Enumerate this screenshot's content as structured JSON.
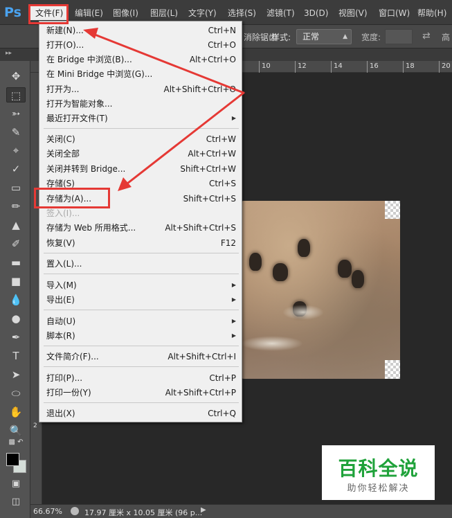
{
  "app": {
    "logo": "Ps"
  },
  "menubar": {
    "items": [
      "文件(F)",
      "编辑(E)",
      "图像(I)",
      "图层(L)",
      "文字(Y)",
      "选择(S)",
      "滤镜(T)",
      "3D(D)",
      "视图(V)",
      "窗口(W)",
      "帮助(H)"
    ]
  },
  "options_bar": {
    "partial_text": "消除锯齿",
    "style_label": "样式:",
    "style_value": "正常",
    "width_label": "宽度:",
    "height_label": "高"
  },
  "ruler": {
    "top_numbers": [
      "10",
      "12",
      "14",
      "16",
      "18",
      "20"
    ],
    "left_numbers": [
      "2"
    ]
  },
  "tools": [
    "move-tool",
    "marquee-tool",
    "lasso-tool",
    "quick-select-tool",
    "crop-tool",
    "eyedropper-tool",
    "healing-brush-tool",
    "brush-tool",
    "clone-stamp-tool",
    "history-brush-tool",
    "eraser-tool",
    "gradient-tool",
    "blur-tool",
    "dodge-tool",
    "pen-tool",
    "type-tool",
    "path-select-tool",
    "ellipse-tool",
    "hand-tool",
    "zoom-tool"
  ],
  "colors": {
    "foreground": "#000000",
    "background": "#d4ddd8",
    "highlight": "#e53935",
    "watermark_green": "#1fa23a"
  },
  "file_menu": {
    "groups": [
      [
        {
          "label": "新建(N)...",
          "shortcut": "Ctrl+N"
        },
        {
          "label": "打开(O)...",
          "shortcut": "Ctrl+O"
        },
        {
          "label": "在 Bridge 中浏览(B)...",
          "shortcut": "Alt+Ctrl+O"
        },
        {
          "label": "在 Mini Bridge 中浏览(G)...",
          "shortcut": ""
        },
        {
          "label": "打开为...",
          "shortcut": "Alt+Shift+Ctrl+O"
        },
        {
          "label": "打开为智能对象...",
          "shortcut": ""
        },
        {
          "label": "最近打开文件(T)",
          "shortcut": "",
          "submenu": true
        }
      ],
      [
        {
          "label": "关闭(C)",
          "shortcut": "Ctrl+W"
        },
        {
          "label": "关闭全部",
          "shortcut": "Alt+Ctrl+W"
        },
        {
          "label": "关闭并转到 Bridge...",
          "shortcut": "Shift+Ctrl+W"
        },
        {
          "label": "存储(S)",
          "shortcut": "Ctrl+S"
        },
        {
          "label": "存储为(A)...",
          "shortcut": "Shift+Ctrl+S"
        },
        {
          "label": "签入(I)...",
          "shortcut": "",
          "disabled": true
        },
        {
          "label": "存储为 Web 所用格式...",
          "shortcut": "Alt+Shift+Ctrl+S"
        },
        {
          "label": "恢复(V)",
          "shortcut": "F12"
        }
      ],
      [
        {
          "label": "置入(L)...",
          "shortcut": ""
        }
      ],
      [
        {
          "label": "导入(M)",
          "shortcut": "",
          "submenu": true
        },
        {
          "label": "导出(E)",
          "shortcut": "",
          "submenu": true
        }
      ],
      [
        {
          "label": "自动(U)",
          "shortcut": "",
          "submenu": true
        },
        {
          "label": "脚本(R)",
          "shortcut": "",
          "submenu": true
        }
      ],
      [
        {
          "label": "文件简介(F)...",
          "shortcut": "Alt+Shift+Ctrl+I"
        }
      ],
      [
        {
          "label": "打印(P)...",
          "shortcut": "Ctrl+P"
        },
        {
          "label": "打印一份(Y)",
          "shortcut": "Alt+Shift+Ctrl+P"
        }
      ],
      [
        {
          "label": "退出(X)",
          "shortcut": "Ctrl+Q"
        }
      ]
    ]
  },
  "status_bar": {
    "zoom": "66.67%",
    "doc_info": "17.97 厘米 x 10.05 厘米 (96 p..."
  },
  "watermark": {
    "title": "百科全说",
    "subtitle": "助你轻松解决"
  }
}
